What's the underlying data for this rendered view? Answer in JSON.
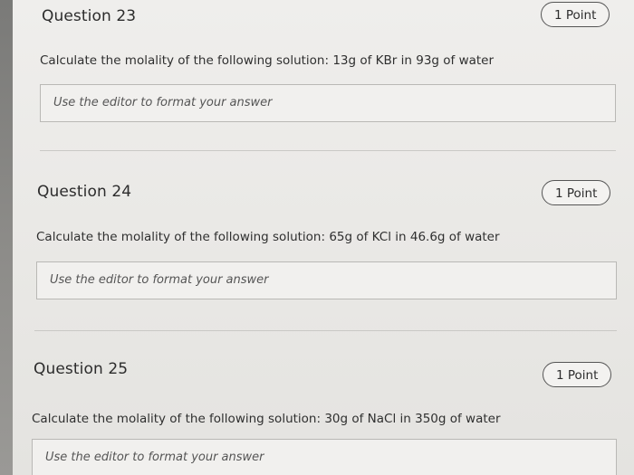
{
  "questions": [
    {
      "title": "Question 23",
      "points": "1 Point",
      "prompt": "Calculate the molality of the following solution: 13g of KBr in 93g of water",
      "answer_placeholder": "Use the editor to format your answer"
    },
    {
      "title": "Question 24",
      "points": "1 Point",
      "prompt": "Calculate the molality of the following solution: 65g of KCl in 46.6g of water",
      "answer_placeholder": "Use the editor to format your answer"
    },
    {
      "title": "Question 25",
      "points": "1 Point",
      "prompt": "Calculate the molality of the following solution: 30g of NaCl in 350g of water",
      "answer_placeholder": "Use the editor to format your answer"
    }
  ]
}
